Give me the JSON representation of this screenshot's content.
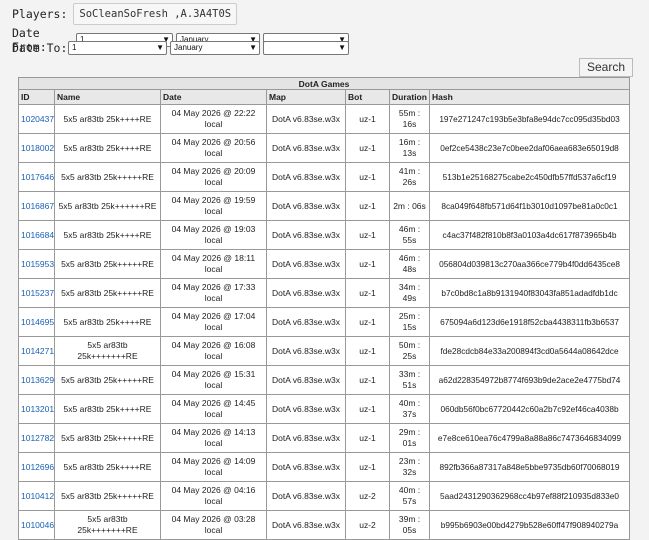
{
  "players": {
    "label": "Players:",
    "value": "SoCleanSoFresh ,A.3A4T0S"
  },
  "date_from": {
    "label": "Date From:",
    "day": "1",
    "month": "January",
    "year": ""
  },
  "date_to": {
    "label": "Date To:",
    "day": "1",
    "month": "January",
    "year": ""
  },
  "search_label": "Search",
  "table": {
    "caption": "DotA Games",
    "headers": [
      "ID",
      "Name",
      "Date",
      "Map",
      "Bot",
      "Duration",
      "Hash"
    ],
    "rows": [
      {
        "id": "1020437",
        "name": "5x5 ar83tb 25k++++RE",
        "date": "04 May 2026 @ 22:22 local",
        "map": "DotA v6.83se.w3x",
        "bot": "uz-1",
        "duration": "55m : 16s",
        "hash": "197e271247c193b5e3bfa8e94dc7cc095d35bd03"
      },
      {
        "id": "1018002",
        "name": "5x5 ar83tb 25k++++RE",
        "date": "04 May 2026 @ 20:56 local",
        "map": "DotA v6.83se.w3x",
        "bot": "uz-1",
        "duration": "16m : 13s",
        "hash": "0ef2ce5438c23e7c0bee2daf06aea683e65019d8"
      },
      {
        "id": "1017646",
        "name": "5x5 ar83tb 25k+++++RE",
        "date": "04 May 2026 @ 20:09 local",
        "map": "DotA v6.83se.w3x",
        "bot": "uz-1",
        "duration": "41m : 26s",
        "hash": "513b1e25168275cabe2c450dfb57ffd537a6cf19"
      },
      {
        "id": "1016867",
        "name": "5x5 ar83tb 25k++++++RE",
        "date": "04 May 2026 @ 19:59 local",
        "map": "DotA v6.83se.w3x",
        "bot": "uz-1",
        "duration": "2m : 06s",
        "hash": "8ca049f648fb571d64f1b3010d1097be81a0c0c1"
      },
      {
        "id": "1016684",
        "name": "5x5 ar83tb 25k++++RE",
        "date": "04 May 2026 @ 19:03 local",
        "map": "DotA v6.83se.w3x",
        "bot": "uz-1",
        "duration": "46m : 55s",
        "hash": "c4ac37f482f810b8f3a0103a4dc617f873965b4b"
      },
      {
        "id": "1015953",
        "name": "5x5 ar83tb 25k+++++RE",
        "date": "04 May 2026 @ 18:11 local",
        "map": "DotA v6.83se.w3x",
        "bot": "uz-1",
        "duration": "46m : 48s",
        "hash": "056804d039813c270aa366ce779b4f0dd6435ce8"
      },
      {
        "id": "1015237",
        "name": "5x5 ar83tb 25k+++++RE",
        "date": "04 May 2026 @ 17:33 local",
        "map": "DotA v6.83se.w3x",
        "bot": "uz-1",
        "duration": "34m : 49s",
        "hash": "b7c0bd8c1a8b9131940f83043fa851adadfdb1dc"
      },
      {
        "id": "1014695",
        "name": "5x5 ar83tb 25k++++RE",
        "date": "04 May 2026 @ 17:04 local",
        "map": "DotA v6.83se.w3x",
        "bot": "uz-1",
        "duration": "25m : 15s",
        "hash": "675094a6d123d6e1918f52cba4438311fb3b6537"
      },
      {
        "id": "1014271",
        "name": "5x5 ar83tb 25k+++++++RE",
        "date": "04 May 2026 @ 16:08 local",
        "map": "DotA v6.83se.w3x",
        "bot": "uz-1",
        "duration": "50m : 25s",
        "hash": "fde28cdcb84e33a200894f3cd0a5644a08642dce"
      },
      {
        "id": "1013629",
        "name": "5x5 ar83tb 25k+++++RE",
        "date": "04 May 2026 @ 15:31 local",
        "map": "DotA v6.83se.w3x",
        "bot": "uz-1",
        "duration": "33m : 51s",
        "hash": "a62d228354972b8774f693b9de2ace2e4775bd74"
      },
      {
        "id": "1013201",
        "name": "5x5 ar83tb 25k++++RE",
        "date": "04 May 2026 @ 14:45 local",
        "map": "DotA v6.83se.w3x",
        "bot": "uz-1",
        "duration": "40m : 37s",
        "hash": "060db56f0bc67720442c60a2b7c92ef46ca4038b"
      },
      {
        "id": "1012782",
        "name": "5x5 ar83tb 25k+++++RE",
        "date": "04 May 2026 @ 14:13 local",
        "map": "DotA v6.83se.w3x",
        "bot": "uz-1",
        "duration": "29m : 01s",
        "hash": "e7e8ce610ea76c4799a8a88a86c7473646834099"
      },
      {
        "id": "1012696",
        "name": "5x5 ar83tb 25k++++RE",
        "date": "04 May 2026 @ 14:09 local",
        "map": "DotA v6.83se.w3x",
        "bot": "uz-1",
        "duration": "23m : 32s",
        "hash": "892fb366a87317a848e5bbe9735db60f70068019"
      },
      {
        "id": "1010412",
        "name": "5x5 ar83tb 25k+++++RE",
        "date": "04 May 2026 @ 04:16 local",
        "map": "DotA v6.83se.w3x",
        "bot": "uz-2",
        "duration": "40m : 57s",
        "hash": "5aad2431290362968cc4b97ef88f210935d833e0"
      },
      {
        "id": "1010046",
        "name": "5x5 ar83tb 25k+++++++RE",
        "date": "04 May 2026 @ 03:28 local",
        "map": "DotA v6.83se.w3x",
        "bot": "uz-2",
        "duration": "39m : 05s",
        "hash": "b995b6903e00bd4279b528e60ff47f908940279a"
      }
    ]
  }
}
